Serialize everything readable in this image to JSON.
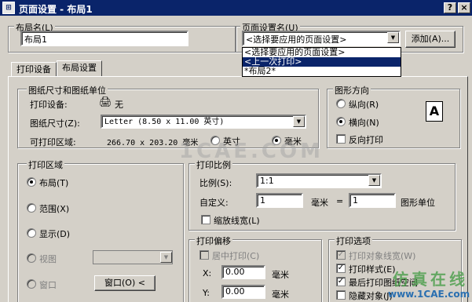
{
  "window": {
    "title": "页面设置 - 布局1",
    "icon_name": "autocad-app-icon",
    "help_btn": "?",
    "close_btn": "×"
  },
  "layout_name": {
    "label": "布局名(L)",
    "value": "布局1"
  },
  "page_setup_name": {
    "label": "页面设置名(U)",
    "selected": "<选择要应用的页面设置>",
    "options": [
      "<选择要应用的页面设置>",
      "<上一次打印>",
      "*布局2*"
    ],
    "highlighted_index": 1,
    "add_button": "添加(A)..."
  },
  "tabs": [
    {
      "label": "打印设备",
      "active": false
    },
    {
      "label": "布局设置",
      "active": true
    }
  ],
  "paper_size_group": {
    "title": "图纸尺寸和图纸单位",
    "device_label": "打印设备:",
    "device_value": "无",
    "size_label": "图纸尺寸(Z):",
    "size_value": "Letter (8.50 x 11.00 英寸)",
    "area_label": "可打印区域:",
    "area_value": "266.70 x 203.20  毫米",
    "unit_inch": "英寸",
    "unit_mm": "毫米",
    "unit_selected": "mm"
  },
  "orientation_group": {
    "title": "图形方向",
    "portrait": "纵向(R)",
    "landscape": "横向(N)",
    "selected": "landscape",
    "reverse": "反向打印",
    "reverse_checked": false
  },
  "plot_area_group": {
    "title": "打印区域",
    "layout": "布局(T)",
    "extents": "范围(X)",
    "display": "显示(D)",
    "view": "视图",
    "window": "窗口",
    "window_button": "窗口(O) <",
    "selected": "layout"
  },
  "plot_scale_group": {
    "title": "打印比例",
    "scale_label": "比例(S):",
    "scale_value": "1:1",
    "custom_label": "自定义:",
    "custom_value1": "1",
    "custom_unit1": "毫米",
    "equals": "=",
    "custom_value2": "1",
    "custom_unit2": "图形单位",
    "lineweight": "缩放线宽(L)",
    "lineweight_checked": false
  },
  "plot_offset_group": {
    "title": "打印偏移",
    "center": "居中打印(C)",
    "x_label": "X:",
    "x_value": "0.00",
    "x_unit": "毫米",
    "y_label": "Y:",
    "y_value": "0.00",
    "y_unit": "毫米"
  },
  "plot_options_group": {
    "title": "打印选项",
    "opt1": "打印对象线宽(W)",
    "opt2": "打印样式(E)",
    "opt3": "最后打印图纸空间",
    "opt4": "隐藏对象(J)",
    "opt1_checked": true,
    "opt2_checked": true,
    "opt3_checked": true,
    "opt4_checked": false
  },
  "watermarks": {
    "center": "1CAE.COM",
    "br_main": "仿真在线",
    "br_url": "www.1CAE.com"
  }
}
